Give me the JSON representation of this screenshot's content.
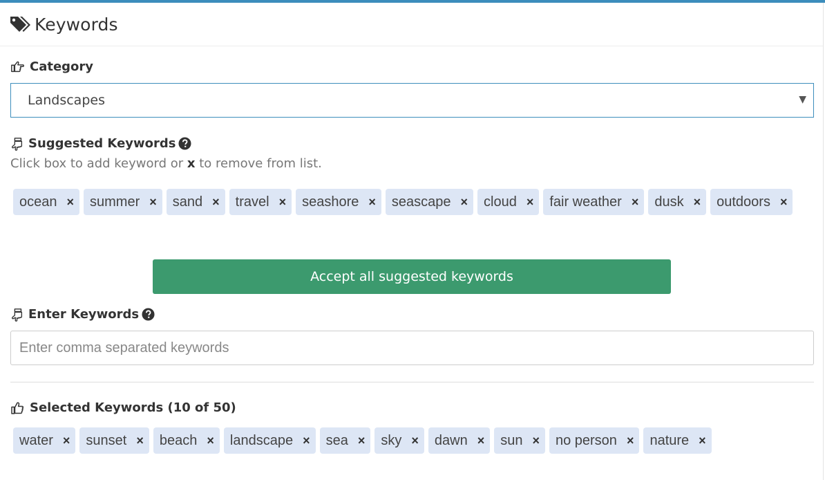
{
  "header": {
    "title": "Keywords",
    "icon": "tags-icon"
  },
  "category": {
    "label": "Category",
    "icon": "hand-pointing-right-icon",
    "selected": "Landscapes"
  },
  "suggested": {
    "label": "Suggested Keywords",
    "icon": "hand-pointing-down-icon",
    "hint_before": "Click box to add keyword or ",
    "hint_x": "x",
    "hint_after": " to remove from list.",
    "keywords": [
      "ocean",
      "summer",
      "sand",
      "travel",
      "seashore",
      "seascape",
      "cloud",
      "fair weather",
      "dusk",
      "outdoors"
    ],
    "accept_label": "Accept all suggested keywords"
  },
  "enter": {
    "label": "Enter Keywords",
    "icon": "hand-pointing-down-icon",
    "placeholder": "Enter comma separated keywords",
    "value": ""
  },
  "selected": {
    "label": "Selected Keywords (10 of 50)",
    "icon": "thumbs-up-icon",
    "keywords": [
      "water",
      "sunset",
      "beach",
      "landscape",
      "sea",
      "sky",
      "dawn",
      "sun",
      "no person",
      "nature"
    ]
  },
  "remove_glyph": "×",
  "colors": {
    "accent": "#3c8dbc",
    "chip_bg": "#dde6f5",
    "accept_button": "#3c9a6e"
  }
}
